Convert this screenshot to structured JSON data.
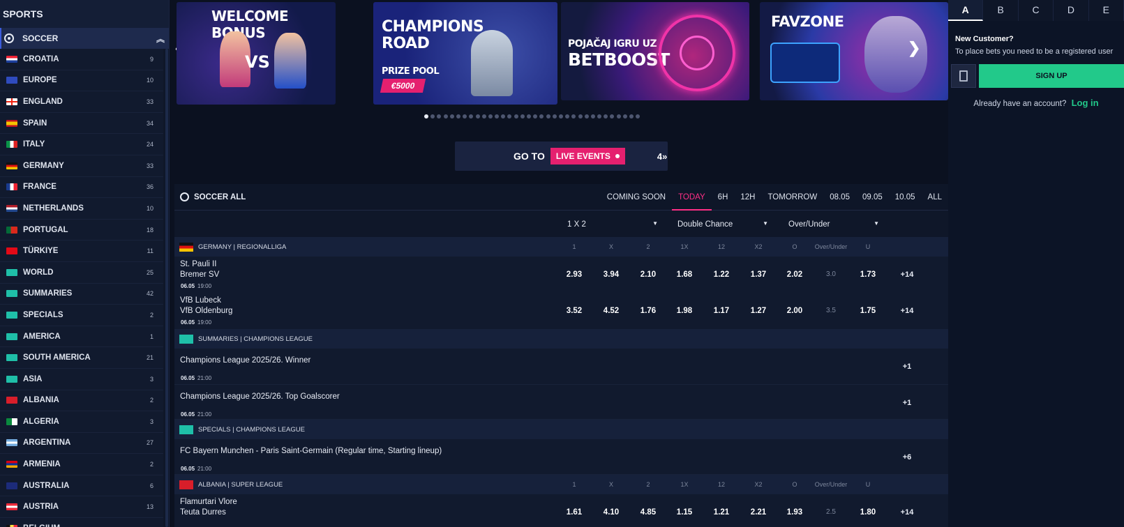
{
  "sidebar": {
    "title": "SPORTS",
    "sport": "SOCCER",
    "items": [
      {
        "label": "CROATIA",
        "count": "9",
        "flag": "croatia"
      },
      {
        "label": "EUROPE",
        "count": "10",
        "flag": "europe"
      },
      {
        "label": "ENGLAND",
        "count": "33",
        "flag": "england"
      },
      {
        "label": "SPAIN",
        "count": "34",
        "flag": "spain"
      },
      {
        "label": "ITALY",
        "count": "24",
        "flag": "italy"
      },
      {
        "label": "GERMANY",
        "count": "33",
        "flag": "germany"
      },
      {
        "label": "FRANCE",
        "count": "36",
        "flag": "france"
      },
      {
        "label": "NETHERLANDS",
        "count": "10",
        "flag": "netherlands"
      },
      {
        "label": "PORTUGAL",
        "count": "18",
        "flag": "portugal"
      },
      {
        "label": "TÜRKIYE",
        "count": "11",
        "flag": "turkiye"
      },
      {
        "label": "WORLD",
        "count": "25",
        "flag": "world"
      },
      {
        "label": "SUMMARIES",
        "count": "42",
        "flag": "world"
      },
      {
        "label": "SPECIALS",
        "count": "2",
        "flag": "world"
      },
      {
        "label": "AMERICA",
        "count": "1",
        "flag": "world"
      },
      {
        "label": "SOUTH AMERICA",
        "count": "21",
        "flag": "world"
      },
      {
        "label": "ASIA",
        "count": "3",
        "flag": "world"
      },
      {
        "label": "ALBANIA",
        "count": "2",
        "flag": "albania"
      },
      {
        "label": "ALGERIA",
        "count": "3",
        "flag": "algeria"
      },
      {
        "label": "ARGENTINA",
        "count": "27",
        "flag": "argentina"
      },
      {
        "label": "ARMENIA",
        "count": "2",
        "flag": "armenia"
      },
      {
        "label": "AUSTRALIA",
        "count": "6",
        "flag": "australia"
      },
      {
        "label": "AUSTRIA",
        "count": "13",
        "flag": "austria"
      },
      {
        "label": "BELGIUM",
        "count": "",
        "flag": "belgium"
      }
    ]
  },
  "banners": {
    "b1": {
      "title": "WELCOME BONUS",
      "vs": "VS"
    },
    "b2": {
      "title": "CHAMPIONS ROAD",
      "sub": "PRIZE POOL",
      "prize": "€5000"
    },
    "b3": {
      "line1": "POJAČAJ IGRU UZ",
      "line2": "BETBOOST"
    },
    "b4": {
      "title": "FAVZONE"
    },
    "dot_count": 34,
    "active_dot": 0
  },
  "golive": {
    "goto": "GO TO",
    "live": "LIVE EVENTS",
    "count": "4»"
  },
  "events": {
    "title": "SOCCER ALL",
    "tabs": [
      "COMING SOON",
      "TODAY",
      "6H",
      "12H",
      "TOMORROW",
      "08.05",
      "09.05",
      "10.05",
      "ALL"
    ],
    "active_tab": "TODAY",
    "selects": [
      "1 X 2",
      "Double Chance",
      "Over/Under"
    ],
    "odds_headers": [
      "1",
      "X",
      "2",
      "1X",
      "12",
      "X2",
      "O",
      "Over/Under",
      "U"
    ],
    "league1": "GERMANY | REGIONALLIGA",
    "match1": {
      "home": "St. Pauli II",
      "away": "Bremer SV",
      "date": "06.05",
      "time": "19:00",
      "odds": [
        "2.93",
        "3.94",
        "2.10",
        "1.68",
        "1.22",
        "1.37",
        "2.02",
        "3.0",
        "1.73"
      ],
      "more": "+14"
    },
    "match2": {
      "home": "VfB Lubeck",
      "away": "VfB Oldenburg",
      "date": "06.05",
      "time": "19:00",
      "odds": [
        "3.52",
        "4.52",
        "1.76",
        "1.98",
        "1.17",
        "1.27",
        "2.00",
        "3.5",
        "1.75"
      ],
      "more": "+14"
    },
    "league2": "SUMMARIES | CHAMPIONS LEAGUE",
    "out1": {
      "name": "Champions League 2025/26. Winner",
      "date": "06.05",
      "time": "21:00",
      "more": "+1"
    },
    "out2": {
      "name": "Champions League 2025/26. Top Goalscorer",
      "date": "06.05",
      "time": "21:00",
      "more": "+1"
    },
    "league3": "SPECIALS | CHAMPIONS LEAGUE",
    "out3": {
      "name": "FC Bayern Munchen - Paris Saint-Germain (Regular time, Starting lineup)",
      "date": "06.05",
      "time": "21:00",
      "more": "+6"
    },
    "league4": "ALBANIA | SUPER LEAGUE",
    "match3": {
      "home": "Flamurtari Vlore",
      "away": "Teuta Durres",
      "odds": [
        "1.61",
        "4.10",
        "4.85",
        "1.15",
        "1.21",
        "2.21",
        "1.93",
        "2.5",
        "1.80"
      ],
      "more": "+14"
    }
  },
  "right": {
    "tabs": [
      "A",
      "B",
      "C",
      "D",
      "E"
    ],
    "active_tab": "A",
    "new_customer": "New Customer?",
    "sub": "To place bets you need to be a registered user",
    "signup": "SIGN UP",
    "already": "Already have an account?",
    "login": "Log in"
  },
  "colors": {
    "accent_pink": "#e5206f",
    "accent_green": "#22c98a",
    "bg": "#0b1120"
  }
}
